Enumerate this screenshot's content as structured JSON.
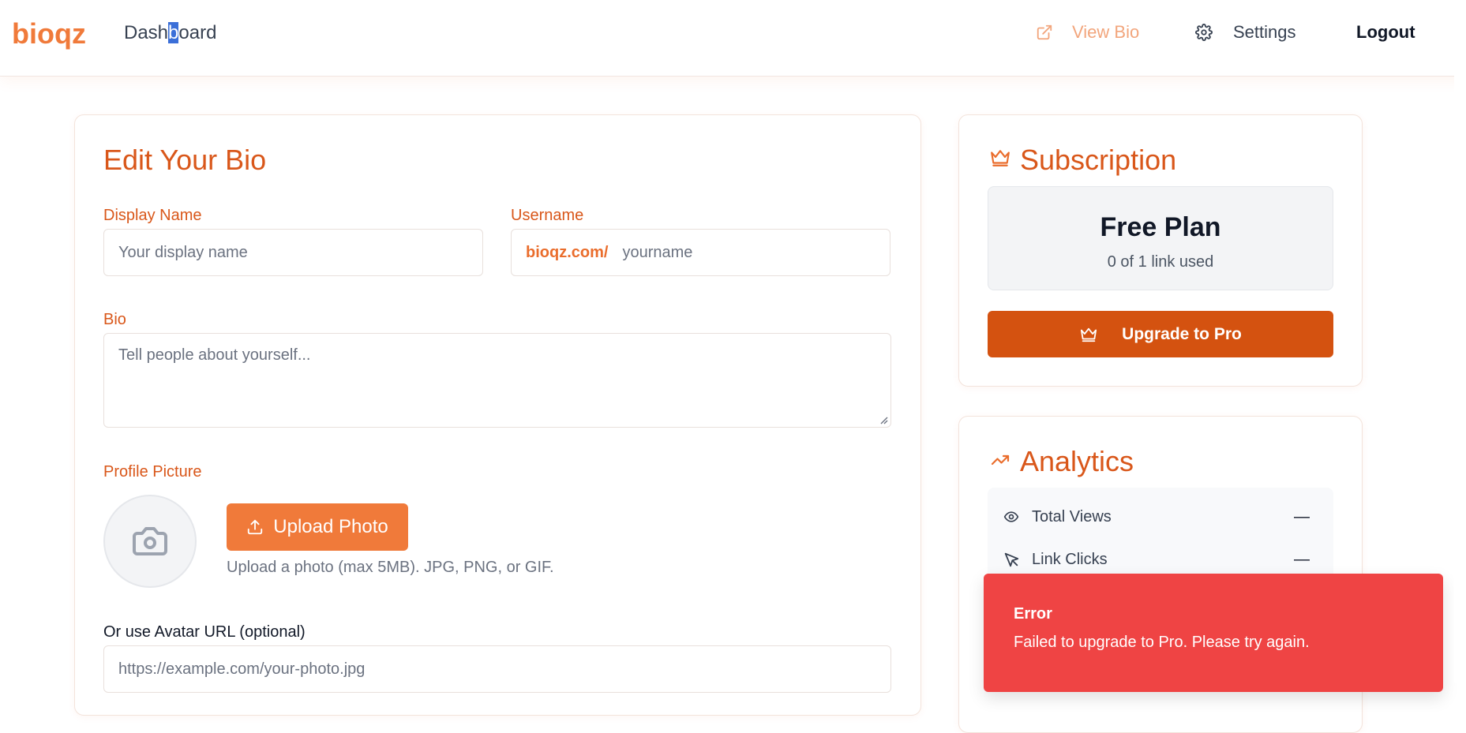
{
  "brand": {
    "logo": "bioqz",
    "accent": "#f07a3a",
    "accent_dark": "#d45210",
    "error": "#ef4444"
  },
  "nav": {
    "dashboard": {
      "before": "Dash",
      "selected": "b",
      "after": "oard"
    },
    "view_bio": "View Bio",
    "settings": "Settings",
    "logout": "Logout"
  },
  "edit_bio": {
    "title": "Edit Your Bio",
    "display_name": {
      "label": "Display Name",
      "placeholder": "Your display name"
    },
    "username": {
      "label": "Username",
      "prefix": "bioqz.com/",
      "placeholder": "yourname"
    },
    "bio": {
      "label": "Bio",
      "placeholder": "Tell people about yourself..."
    },
    "profile_picture": {
      "label": "Profile Picture",
      "upload_button": "Upload Photo",
      "help": "Upload a photo (max 5MB). JPG, PNG, or GIF."
    },
    "avatar_url": {
      "label": "Or use Avatar URL (optional)",
      "placeholder": "https://example.com/your-photo.jpg"
    }
  },
  "subscription": {
    "title": "Subscription",
    "plan_name": "Free Plan",
    "usage": "0 of 1 link used",
    "upgrade_button": "Upgrade to Pro"
  },
  "analytics": {
    "title": "Analytics",
    "stats": [
      {
        "label": "Total Views",
        "value": "—",
        "icon": "eye-icon"
      },
      {
        "label": "Link Clicks",
        "value": "—",
        "icon": "cursor-icon"
      }
    ]
  },
  "toast": {
    "title": "Error",
    "message": "Failed to upgrade to Pro. Please try again."
  }
}
